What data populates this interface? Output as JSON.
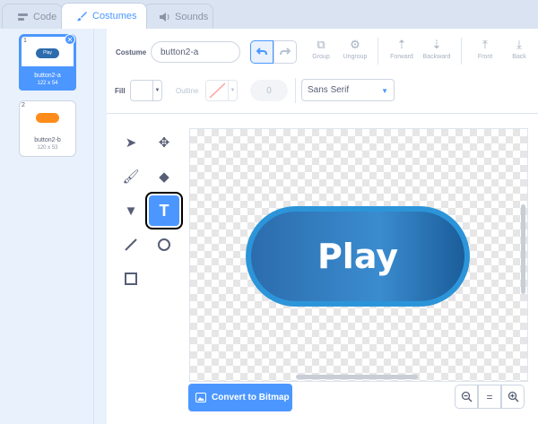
{
  "tabs": [
    {
      "label": "Code",
      "icon": "code-icon"
    },
    {
      "label": "Costumes",
      "icon": "brush-icon"
    },
    {
      "label": "Sounds",
      "icon": "speaker-icon"
    }
  ],
  "costumes": [
    {
      "num": "1",
      "name": "button2-a",
      "size": "122 x 54",
      "thumb_label": "Play",
      "thumb_color": "#2c6cad"
    },
    {
      "num": "2",
      "name": "button2-b",
      "size": "120 x 53",
      "thumb_label": "",
      "thumb_color": "#ff8c1a"
    }
  ],
  "toolbar": {
    "costume_label": "Costume",
    "costume_name": "button2-a",
    "group": "Group",
    "ungroup": "Ungroup",
    "forward": "Forward",
    "backward": "Backward",
    "front": "Front",
    "back": "Back"
  },
  "properties": {
    "fill_label": "Fill",
    "outline_label": "Outline",
    "outline_width": "0",
    "font": "Sans Serif"
  },
  "canvas": {
    "button_text": "Play"
  },
  "actions": {
    "convert_label": "Convert to Bitmap",
    "zoom_out": "−",
    "zoom_reset": "=",
    "zoom_in": "+"
  },
  "colors": {
    "accent": "#4c97ff",
    "play_button": "#2c6cad",
    "orange_button": "#ff8c1a"
  }
}
